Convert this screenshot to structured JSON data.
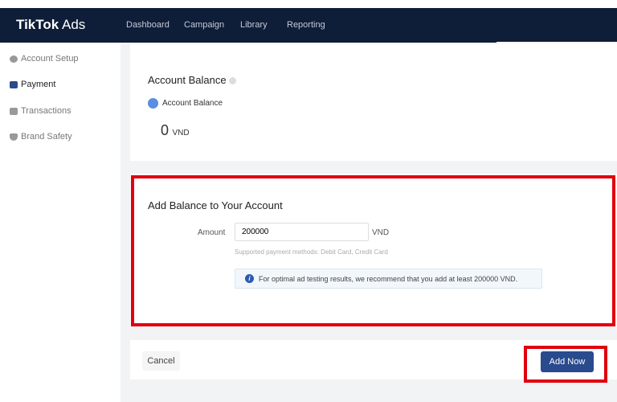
{
  "header": {
    "logo_bold": "TikTok",
    "logo_rest": " Ads",
    "nav": [
      "Dashboard",
      "Campaign",
      "Library",
      "Reporting"
    ]
  },
  "sidebar": {
    "items": [
      {
        "label": "Account Setup",
        "icon": "gear-icon"
      },
      {
        "label": "Payment",
        "icon": "wallet-icon",
        "active": true
      },
      {
        "label": "Transactions",
        "icon": "transactions-icon"
      },
      {
        "label": "Brand Safety",
        "icon": "shield-icon"
      }
    ]
  },
  "balance": {
    "title": "Account Balance",
    "sub_label": "Account Balance",
    "value": "0",
    "currency": "VND"
  },
  "add_balance": {
    "title": "Add Balance to Your Account",
    "amount_label": "Amount",
    "amount_value": "200000",
    "currency": "VND",
    "methods": "Supported payment methods: Debit Card, Credit Card",
    "notice": "For optimal ad testing results, we recommend that you add at least 200000 VND."
  },
  "footer": {
    "cancel": "Cancel",
    "add_now": "Add Now"
  },
  "colors": {
    "header": "#0e1d38",
    "primary": "#2a4a8e",
    "highlight": "#e0000f"
  }
}
